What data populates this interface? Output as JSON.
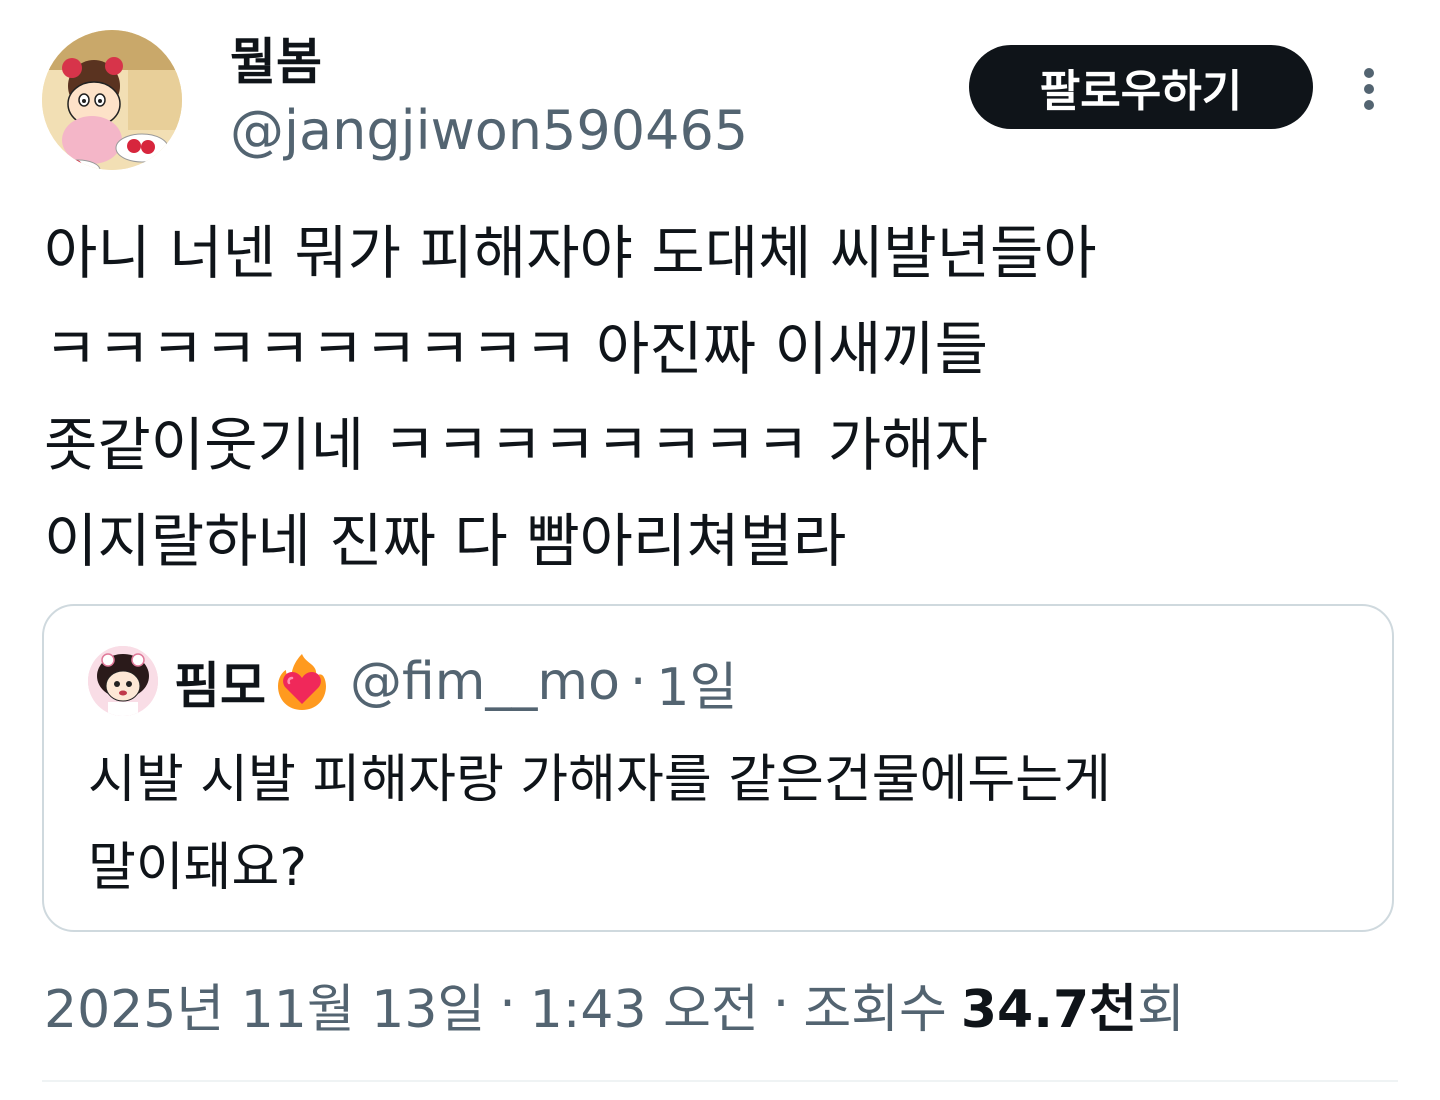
{
  "author": {
    "display_name": "뭘봄",
    "handle": "@jangjiwon590465",
    "avatar_icon": "cartoon-character-avatar"
  },
  "actions": {
    "follow_label": "팔로우하기",
    "more_icon": "more-vertical-icon"
  },
  "tweet": {
    "text": "아니 너넨 뭐가 피해자야 도대체 씨발년들아\nㅋㅋㅋㅋㅋㅋㅋㅋㅋㅋ 아진짜 이새끼들\n좃같이웃기네 ㅋㅋㅋㅋㅋㅋㅋㅋ 가해자\n이지랄하네 진짜 다 빰아리쳐벌라"
  },
  "quote": {
    "display_name": "핌모",
    "emoji": "heart-on-fire",
    "handle": "@fim__mo",
    "separator": "·",
    "time": "1일",
    "text": "시발 시발 피해자랑 가해자를 같은건물에두는게\n말이돼요?"
  },
  "meta": {
    "date": "2025년 11월 13일",
    "sep1": "·",
    "time": "1:43 오전",
    "sep2": "·",
    "views_label": "조회수",
    "views_number": "34.7천",
    "views_suffix": "회"
  },
  "colors": {
    "text_primary": "#0f1419",
    "text_secondary": "#536471",
    "border": "#cfd9de",
    "button_bg": "#0f1419",
    "button_text": "#ffffff"
  }
}
